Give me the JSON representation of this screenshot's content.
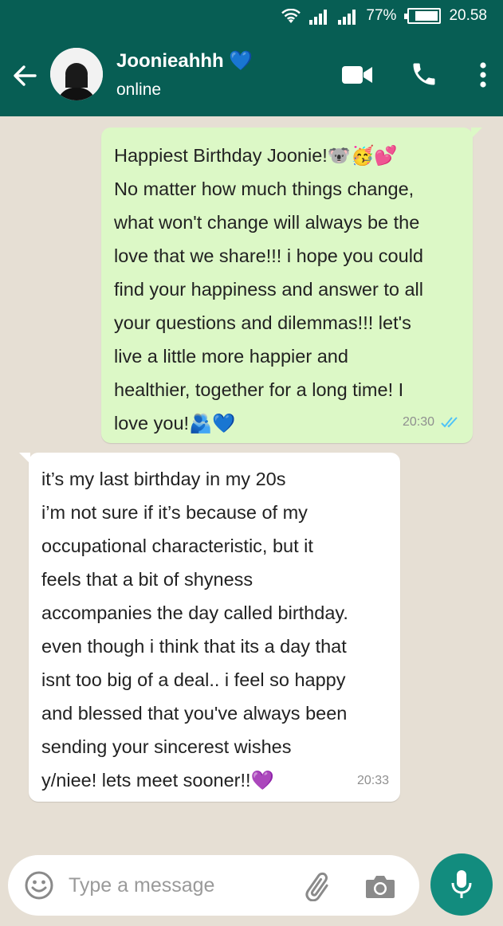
{
  "status_bar": {
    "battery": "77%",
    "time": "20.58"
  },
  "header": {
    "contact_name": "Joonieahhh 💙",
    "status": "online"
  },
  "messages": [
    {
      "direction": "outgoing",
      "lines": [
        "Happiest Birthday Joonie!🐨🥳💕",
        "No matter how much things change,",
        "what won't change will always be the",
        "love that we share!!! i hope you could",
        "find your happiness and answer to all",
        "your questions and dilemmas!!! let's",
        "live a little more happier and",
        "healthier, together for a long time! I",
        "love you!🫂💙"
      ],
      "time": "20:30",
      "read": true
    },
    {
      "direction": "incoming",
      "lines": [
        "it’s my last birthday in my 20s",
        "i’m not sure if it’s because of my",
        "occupational characteristic, but it",
        "feels that a bit of shyness",
        "accompanies the day called birthday.",
        "even though i think that its a day that",
        "isnt too big of a deal.. i feel so happy",
        "and blessed that you've always been",
        "sending your sincerest wishes",
        "y/niee! lets meet sooner!!💜"
      ],
      "time": "20:33"
    }
  ],
  "composer": {
    "placeholder": "Type a message"
  },
  "colors": {
    "header": "#075e54",
    "outgoing_bubble": "#dcf8c6",
    "incoming_bubble": "#ffffff",
    "chat_background": "#e6dfd4",
    "mic_button": "#128c7e",
    "read_ticks": "#4fc3f7"
  },
  "icons": [
    "wifi-icon",
    "signal-icon",
    "battery-icon",
    "back-arrow-icon",
    "video-call-icon",
    "phone-icon",
    "more-vert-icon",
    "emoji-icon",
    "paperclip-icon",
    "camera-icon",
    "microphone-icon",
    "double-check-icon"
  ]
}
